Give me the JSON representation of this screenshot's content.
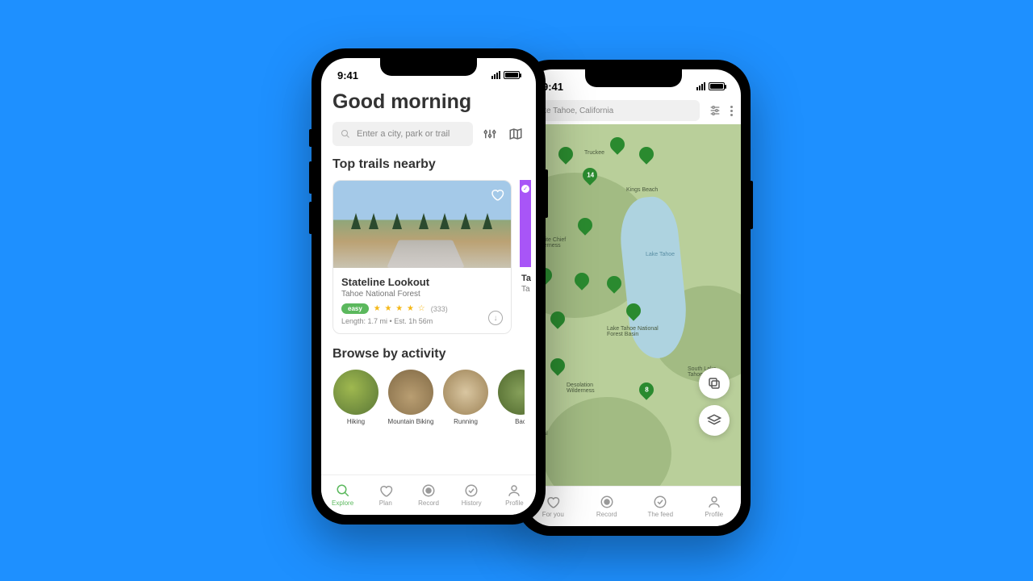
{
  "status": {
    "time": "9:41"
  },
  "front": {
    "greeting": "Good morning",
    "search_placeholder": "Enter a city, park or trail",
    "top_trails_title": "Top trails nearby",
    "trail": {
      "name": "Stateline Lookout",
      "location": "Tahoe National Forest",
      "difficulty": "easy",
      "reviews": "(333)",
      "stats": "Length: 1.7 mi  •  Est. 1h 56m"
    },
    "peek_trail_name": "Ta",
    "peek_trail_loc": "Ta",
    "browse_title": "Browse by activity",
    "activities": [
      "Hiking",
      "Mountain Biking",
      "Running",
      "Bac"
    ],
    "tabs": [
      "Explore",
      "Plan",
      "Record",
      "History",
      "Profile"
    ]
  },
  "back": {
    "search_value": "ke Tahoe, California",
    "tabs": [
      "For you",
      "Record",
      "The feed",
      "Profile"
    ],
    "map_labels": {
      "truckee": "Truckee",
      "kings_beach": "Kings Beach",
      "granite": "Granite Chief Wilderness",
      "lake": "Lake Tahoe",
      "basin": "Lake Tahoe National Forest Basin",
      "desolation": "Desolation Wilderness",
      "south": "South Lake Tahoe",
      "ptional": "ptional"
    },
    "pin_14": "14",
    "pin_8": "8"
  }
}
